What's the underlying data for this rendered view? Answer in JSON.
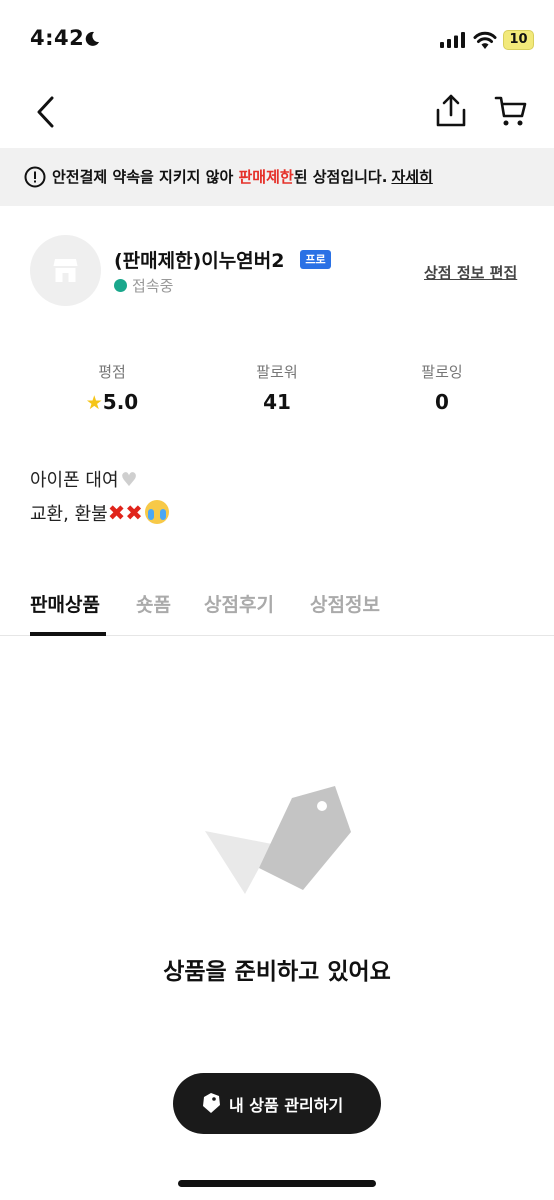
{
  "status_bar": {
    "time": "4:42",
    "battery": "10"
  },
  "nav": {
    "back_icon": "chevron-left-icon",
    "share_icon": "share-icon",
    "cart_icon": "cart-icon"
  },
  "notice": {
    "prefix": "안전결제 약속을 지키지 않아 ",
    "highlight": "판매제한",
    "suffix": "된 상점입니다.",
    "link": "자세히",
    "highlight_color": "#e5312a"
  },
  "shop": {
    "name": "(판매제한)이누엳버2",
    "badge": "프로",
    "status": "접속중",
    "edit_link": "상점 정보 편집"
  },
  "stats": [
    {
      "label": "평점",
      "value": "5.0"
    },
    {
      "label": "팔로워",
      "value": "41"
    },
    {
      "label": "팔로잉",
      "value": "0"
    }
  ],
  "intro": {
    "line1": "아이폰 대여",
    "line2": "교환, 환불"
  },
  "tabs": [
    "판매상품",
    "숏폼",
    "상점후기",
    "상점정보"
  ],
  "empty_state": {
    "message": "상품을 준비하고 있어요"
  },
  "manage_button": {
    "label": "내 상품 관리하기"
  }
}
